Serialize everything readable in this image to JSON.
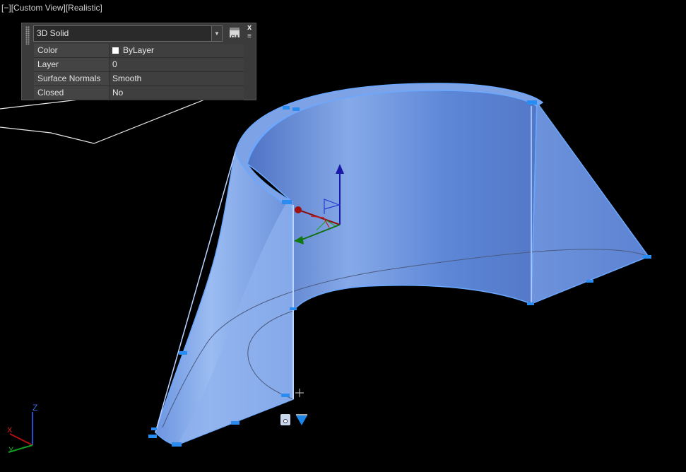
{
  "viewport": {
    "controls": "[−]",
    "view": "[Custom View]",
    "style": "[Realistic]"
  },
  "palette": {
    "selected_type": "3D Solid",
    "properties": [
      {
        "name": "Color",
        "value": "ByLayer"
      },
      {
        "name": "Layer",
        "value": "0"
      },
      {
        "name": "Surface Normals",
        "value": "Smooth"
      },
      {
        "name": "Closed",
        "value": "No"
      }
    ],
    "cui_label": "CUI",
    "close_label": "x",
    "menu_label": "≡"
  },
  "ucs": {
    "z": "Z",
    "x": "X",
    "y": "Y"
  },
  "colors": {
    "background": "#000000",
    "solid_fill": "#5c87d6",
    "solid_edge": "#6aa8ff",
    "grip": "#2a8cf0",
    "palette_bg": "#3b3b3b"
  }
}
